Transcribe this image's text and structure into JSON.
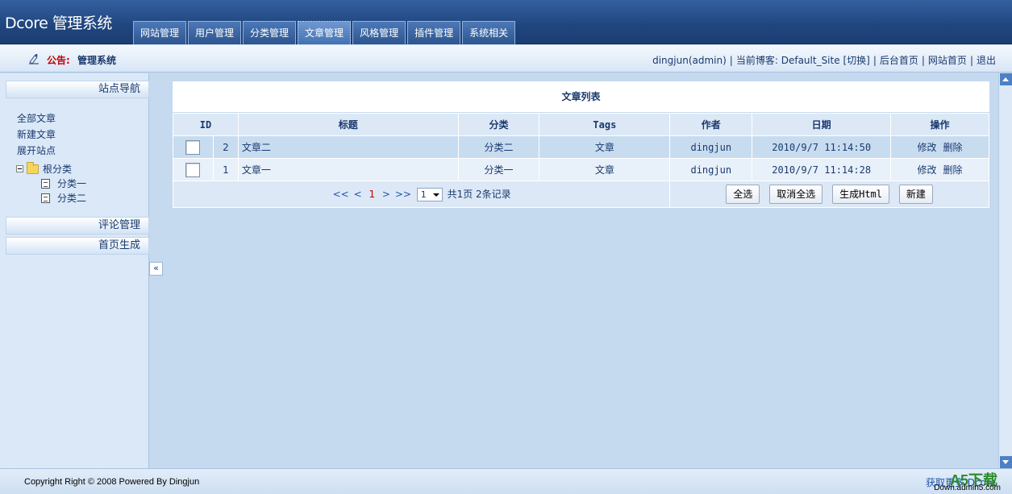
{
  "app": {
    "title": "Dcore 管理系统"
  },
  "tabs": [
    {
      "label": "网站管理"
    },
    {
      "label": "用户管理"
    },
    {
      "label": "分类管理"
    },
    {
      "label": "文章管理"
    },
    {
      "label": "风格管理"
    },
    {
      "label": "插件管理"
    },
    {
      "label": "系统相关"
    }
  ],
  "notice": {
    "label": "公告:",
    "text": "管理系统"
  },
  "user_bar": {
    "user": "dingjun(admin)",
    "current_blog_label": "当前博客:",
    "blog_name": "Default_Site",
    "switch": "[切换]",
    "admin_home": "后台首页",
    "site_home": "网站首页",
    "logout": "退出"
  },
  "sidebar": {
    "site_nav": "站点导航",
    "links": {
      "all_articles": "全部文章",
      "new_article": "新建文章",
      "expand_sites": "展开站点"
    },
    "tree": {
      "root": "根分类",
      "children": [
        "分类一",
        "分类二"
      ]
    },
    "comments": "评论管理",
    "home_gen": "首页生成",
    "collapse": "«"
  },
  "panel": {
    "title": "文章列表",
    "columns": [
      "ID",
      "标题",
      "分类",
      "Tags",
      "作者",
      "日期",
      "操作"
    ],
    "rows": [
      {
        "id": "2",
        "title": "文章二",
        "category": "分类二",
        "tags": "文章",
        "author": "dingjun",
        "date": "2010/9/7 11:14:50",
        "edit": "修改",
        "delete": "删除"
      },
      {
        "id": "1",
        "title": "文章一",
        "category": "分类一",
        "tags": "文章",
        "author": "dingjun",
        "date": "2010/9/7 11:14:28",
        "edit": "修改",
        "delete": "删除"
      }
    ],
    "pager": {
      "first": "<<",
      "prev": "<",
      "current": "1",
      "next": ">",
      "last": ">>",
      "page_select": "1",
      "summary": "共1页 2条记录"
    },
    "buttons": {
      "select_all": "全选",
      "deselect_all": "取消全选",
      "gen_html": "生成Html",
      "new": "新建"
    }
  },
  "footer": {
    "copyright": "Copyright Right © 2008 Powered By Dingjun",
    "more": "获取更多 Dcore",
    "watermark": "A5下载",
    "watermark_url": "Down.admin5.com"
  }
}
